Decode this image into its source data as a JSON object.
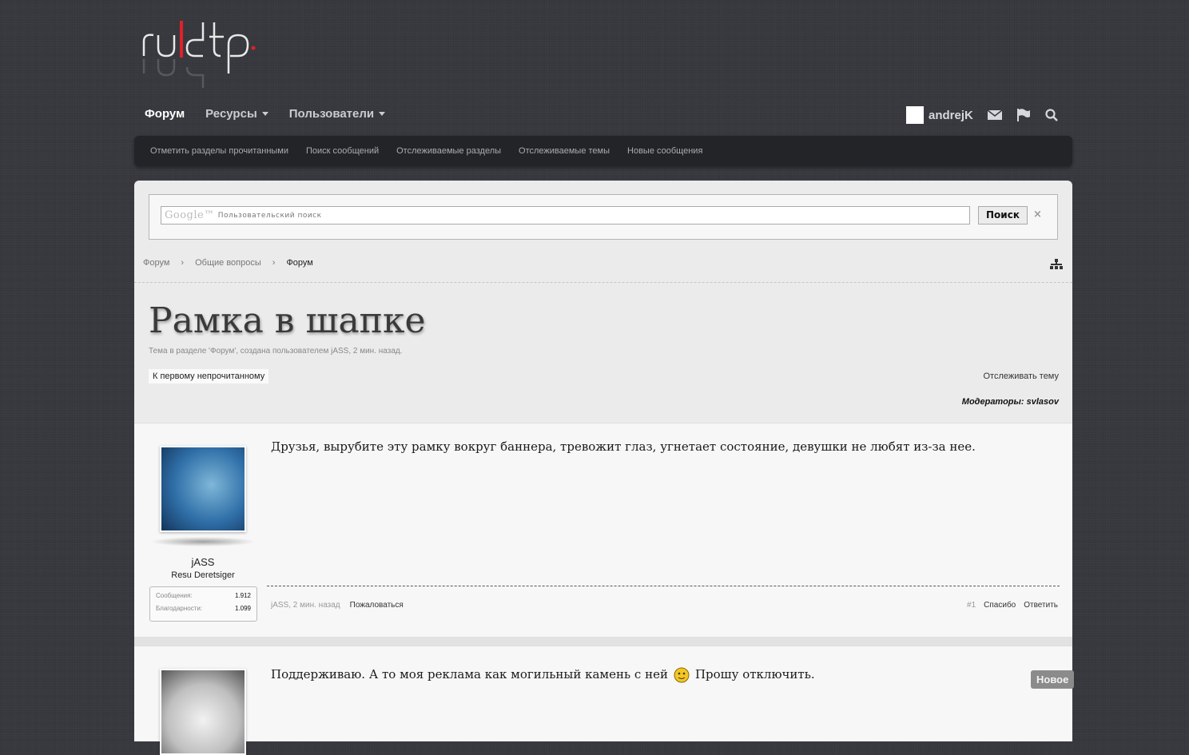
{
  "logo": {
    "text": "ru|dtp"
  },
  "nav": {
    "items": [
      {
        "label": "Форум",
        "active": true
      },
      {
        "label": "Ресурсы"
      },
      {
        "label": "Пользователи"
      }
    ],
    "username": "andrejK"
  },
  "subnav": [
    "Отметить разделы прочитанными",
    "Поиск сообщений",
    "Отслеживаемые разделы",
    "Отслеживаемые темы",
    "Новые сообщения"
  ],
  "search": {
    "brand": "Google™",
    "placeholder": "Пользовательский поиск",
    "button": "Поиск",
    "close": "×"
  },
  "breadcrumb": [
    "Форум",
    "Общие вопросы",
    "Форум"
  ],
  "thread": {
    "title": "Рамка в шапке",
    "subtitle": "Тема в разделе 'Форум', создана пользователем jASS, 2 мин. назад.",
    "unread_button": "К первому непрочитанному",
    "watch": "Отслеживать тему",
    "moderators": "Модераторы: svlasov"
  },
  "posts": [
    {
      "author": "jASS",
      "user_title": "Resu Deretsiger",
      "stats": [
        {
          "label": "Сообщения:",
          "value": "1.912"
        },
        {
          "label": "Благодарности:",
          "value": "1.099"
        }
      ],
      "message": "Друзья, вырубите эту рамку вокруг баннера, тревожит глаз, угнетает состояние, девушки не любят из-за нее.",
      "meta": "jASS, 2 мин. назад",
      "report": "Пожаловаться",
      "number": "#1",
      "thanks": "Спасибо",
      "reply": "Ответить"
    },
    {
      "message_a": "Поддерживаю. А то моя реклама как могильный камень с ней",
      "message_b": "Прошу отключить."
    }
  ],
  "new_badge": "Новое",
  "colors": {
    "accent": "#e0202a",
    "bg": "#37393e",
    "panel": "#ebebeb"
  }
}
